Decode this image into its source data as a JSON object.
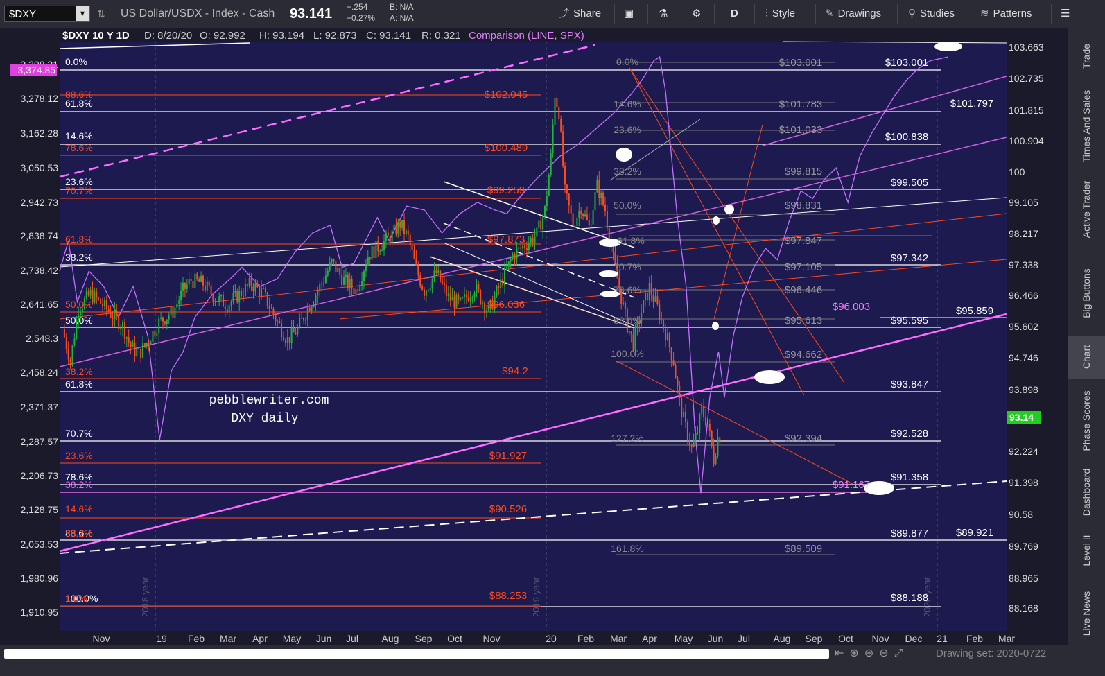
{
  "toolbar": {
    "symbol": "$DXY",
    "description": "US Dollar/USDX - Index - Cash",
    "last": "93.141",
    "change": "+.254",
    "change_pct": "+0.27%",
    "bid": "B: N/A",
    "ask": "A: N/A",
    "share": "Share",
    "period": "D",
    "style": "Style",
    "drawings": "Drawings",
    "studies": "Studies",
    "patterns": "Patterns"
  },
  "header": {
    "title": "$DXY 10 Y 1D",
    "date": "D: 8/20/20",
    "open": "O: 92.992",
    "high": "H: 93.194",
    "low": "L: 92.873",
    "close": "C: 93.141",
    "range": "R: 0.321",
    "comparison": "Comparison (LINE, SPX)"
  },
  "colors": {
    "bg": "#1c1a4e",
    "up": "#22b43a",
    "down": "#ff4a1c",
    "spx": "#c770ff",
    "white": "#ffffff",
    "red": "#ff4a1c",
    "grey": "#8a8a8a"
  },
  "chart_data": {
    "type": "line",
    "ylim": [
      87.6,
      104.4
    ],
    "yticks_right": [
      "103.663",
      "102.735",
      "101.815",
      "100.904",
      "100",
      "99.105",
      "98.217",
      "97.338",
      "96.466",
      "95.602",
      "94.746",
      "93.898",
      "93.057",
      "92.224",
      "91.398",
      "90.58",
      "89.769",
      "88.965",
      "88.168"
    ],
    "yticks_left": [
      "3,398.31",
      "3,278.12",
      "3,162.28",
      "3,050.53",
      "2,942.73",
      "2,838.74",
      "2,738.42",
      "2,641.65",
      "2,548.3",
      "2,458.24",
      "2,371.37",
      "2,287.57",
      "2,206.73",
      "2,128.75",
      "2,053.53",
      "1,980.96",
      "1,910.95"
    ],
    "left_highlight": "3,374.85",
    "last_price_tag": "93.14",
    "xticks": [
      "Nov",
      "19",
      "Feb",
      "Mar",
      "Apr",
      "May",
      "Jun",
      "Jul",
      "Aug",
      "Sep",
      "Oct",
      "Nov",
      "20",
      "Feb",
      "Mar",
      "Apr",
      "May",
      "Jun",
      "Jul",
      "Aug",
      "Sep",
      "Oct",
      "Nov",
      "Dec",
      "21",
      "Feb",
      "Mar"
    ],
    "year_labels": [
      "2018 year",
      "2019 year",
      "2020 year"
    ],
    "watermark": [
      "pebblewriter.com",
      "DXY daily"
    ],
    "dxy_path": [
      [
        0,
        96.2
      ],
      [
        4,
        95.3
      ],
      [
        8,
        96.8
      ],
      [
        14,
        97.2
      ],
      [
        20,
        96.9
      ],
      [
        25,
        96.6
      ],
      [
        30,
        96.3
      ],
      [
        34,
        95.7
      ],
      [
        38,
        95.5
      ],
      [
        43,
        95.9
      ],
      [
        48,
        96.4
      ],
      [
        55,
        96.7
      ],
      [
        60,
        97.3
      ],
      [
        64,
        97.6
      ],
      [
        70,
        97.5
      ],
      [
        76,
        97.1
      ],
      [
        82,
        96.9
      ],
      [
        88,
        97.2
      ],
      [
        94,
        97.5
      ],
      [
        100,
        97.2
      ],
      [
        107,
        96.4
      ],
      [
        112,
        95.9
      ],
      [
        117,
        96.2
      ],
      [
        122,
        96.8
      ],
      [
        128,
        97.4
      ],
      [
        134,
        98.1
      ],
      [
        140,
        97.6
      ],
      [
        146,
        97.3
      ],
      [
        152,
        98.3
      ],
      [
        158,
        98.6
      ],
      [
        164,
        98.9
      ],
      [
        168,
        99.2
      ],
      [
        172,
        98.8
      ],
      [
        176,
        97.9
      ],
      [
        180,
        97.3
      ],
      [
        186,
        97.8
      ],
      [
        192,
        97.1
      ],
      [
        198,
        96.9
      ],
      [
        205,
        97.4
      ],
      [
        212,
        96.7
      ],
      [
        218,
        97.5
      ],
      [
        224,
        98.3
      ],
      [
        230,
        98.6
      ],
      [
        236,
        98.9
      ],
      [
        240,
        99.6
      ],
      [
        243,
        101.1
      ],
      [
        245,
        102.9
      ],
      [
        247,
        102.4
      ],
      [
        250,
        100.1
      ],
      [
        254,
        99.2
      ],
      [
        258,
        99.7
      ],
      [
        262,
        99.1
      ],
      [
        266,
        100.3
      ],
      [
        270,
        99.6
      ],
      [
        274,
        98.2
      ],
      [
        278,
        97.1
      ],
      [
        281,
        96.3
      ],
      [
        284,
        95.8
      ],
      [
        288,
        96.7
      ],
      [
        292,
        97.4
      ],
      [
        296,
        96.8
      ],
      [
        300,
        96.1
      ],
      [
        304,
        95.3
      ],
      [
        307,
        94.1
      ],
      [
        310,
        93.4
      ],
      [
        313,
        92.8
      ],
      [
        316,
        93.3
      ],
      [
        318,
        93.9
      ],
      [
        321,
        93.5
      ],
      [
        324,
        92.5
      ],
      [
        326,
        93.1
      ],
      [
        327,
        93.141
      ]
    ],
    "spx_path": [
      [
        0,
        2820
      ],
      [
        3,
        2900
      ],
      [
        6,
        2740
      ],
      [
        10,
        2820
      ],
      [
        15,
        2780
      ],
      [
        20,
        2700
      ],
      [
        25,
        2780
      ],
      [
        30,
        2650
      ],
      [
        34,
        2380
      ],
      [
        38,
        2560
      ],
      [
        42,
        2610
      ],
      [
        46,
        2700
      ],
      [
        52,
        2760
      ],
      [
        58,
        2800
      ],
      [
        62,
        2830
      ],
      [
        68,
        2780
      ],
      [
        74,
        2800
      ],
      [
        80,
        2870
      ],
      [
        86,
        2920
      ],
      [
        92,
        2940
      ],
      [
        96,
        2830
      ],
      [
        100,
        2840
      ],
      [
        104,
        2900
      ],
      [
        108,
        2960
      ],
      [
        112,
        2900
      ],
      [
        118,
        2990
      ],
      [
        124,
        2980
      ],
      [
        130,
        2920
      ],
      [
        136,
        2970
      ],
      [
        142,
        3000
      ],
      [
        148,
        2980
      ],
      [
        152,
        2970
      ],
      [
        156,
        3010
      ],
      [
        162,
        3060
      ],
      [
        166,
        3090
      ],
      [
        170,
        3120
      ],
      [
        176,
        3150
      ],
      [
        182,
        3190
      ],
      [
        188,
        3230
      ],
      [
        194,
        3280
      ],
      [
        198,
        3320
      ],
      [
        202,
        3370
      ],
      [
        204,
        3380
      ],
      [
        206,
        3290
      ],
      [
        208,
        3120
      ],
      [
        210,
        2960
      ],
      [
        213,
        2780
      ],
      [
        216,
        2400
      ],
      [
        218,
        2240
      ],
      [
        221,
        2490
      ],
      [
        224,
        2610
      ],
      [
        226,
        2490
      ],
      [
        229,
        2650
      ],
      [
        232,
        2750
      ],
      [
        236,
        2830
      ],
      [
        240,
        2880
      ],
      [
        244,
        2850
      ],
      [
        248,
        2950
      ],
      [
        252,
        3030
      ],
      [
        256,
        3010
      ],
      [
        260,
        3060
      ],
      [
        264,
        3090
      ],
      [
        268,
        3000
      ],
      [
        272,
        3120
      ],
      [
        276,
        3180
      ],
      [
        280,
        3230
      ],
      [
        284,
        3280
      ],
      [
        288,
        3320
      ],
      [
        292,
        3350
      ],
      [
        296,
        3370
      ],
      [
        302,
        3380
      ]
    ],
    "fib_left": {
      "white_labels": [
        "0.0%",
        "61.8%",
        "14.6%",
        "23.6%",
        "38.2%",
        "50.0%",
        "61.8%",
        "70.7%",
        "78.6%",
        "88.6%",
        "100.0%"
      ],
      "red_labels": [
        "88.6%",
        "78.6%",
        "70.7%",
        "61.8%",
        "50.0%",
        "38.2%",
        "23.6%",
        "14.6%",
        "38.2%",
        "1.0%"
      ],
      "pink_label": "38.2%"
    },
    "price_labels_red": [
      "$102.045",
      "$100.489",
      "$99.259",
      "$97.873",
      "$96.036",
      "$94.2",
      "$91.927",
      "$90.526",
      "$88.253"
    ],
    "price_labels_white": [
      "$103.001",
      "$100.838",
      "$99.505",
      "$97.342",
      "$95.595",
      "$93.847",
      "$92.528",
      "$91.358",
      "$89.877",
      "$88.188",
      "$101.797",
      "$95.859",
      "$89.921"
    ],
    "price_labels_grey": [
      "$103.001",
      "$101.783",
      "$101.033",
      "$99.815",
      "$98.831",
      "$97.847",
      "$97.105",
      "$96.446",
      "$95.613",
      "$94.662",
      "$92.394",
      "$89.509"
    ],
    "price_labels_pink": [
      "$96.003",
      "$91.167"
    ],
    "mid_fib_labels": [
      "0.0%",
      "14.6%",
      "23.6%",
      "38.2%",
      "50.0%",
      "61.8%",
      "70.7%",
      "78.6%",
      "88.6%",
      "100.0%",
      "127.2%",
      "161.8%"
    ]
  },
  "right_tabs": [
    "Trade",
    "Times And Sales",
    "Active Trader",
    "Big Buttons",
    "Chart",
    "Phase Scores",
    "Dashboard",
    "Level II",
    "Live News"
  ],
  "bottom": {
    "drawing_set": "Drawing set: 2020-0722"
  }
}
